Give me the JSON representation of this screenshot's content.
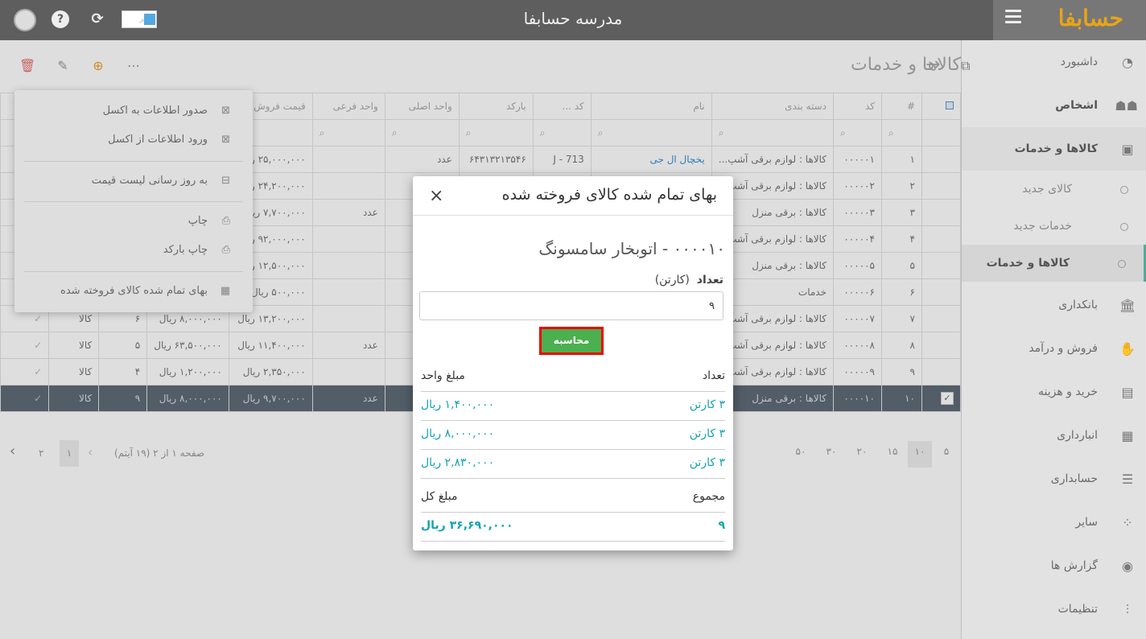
{
  "topbar": {
    "title": "مدرسه حسابفا",
    "brand": "حسابفا",
    "logo_box_text": "خبر"
  },
  "sidebar": {
    "items": [
      {
        "label": "داشبورد",
        "icon": "dashboard-icon"
      },
      {
        "label": "اشخاص",
        "icon": "people-icon"
      },
      {
        "label": "کالاها و خدمات",
        "icon": "box-icon"
      },
      {
        "label": "بانکداری",
        "icon": "bank-icon"
      },
      {
        "label": "فروش و درآمد",
        "icon": "sales-icon"
      },
      {
        "label": "خرید و هزینه",
        "icon": "wallet-icon"
      },
      {
        "label": "انبارداری",
        "icon": "warehouse-icon"
      },
      {
        "label": "حسابداری",
        "icon": "ledger-icon"
      },
      {
        "label": "سایر",
        "icon": "other-icon"
      },
      {
        "label": "گزارش ها",
        "icon": "report-icon"
      },
      {
        "label": "تنظیمات",
        "icon": "settings-icon"
      }
    ],
    "subitems": [
      "کالای جدید",
      "خدمات جدید",
      "کالاها و خدمات"
    ]
  },
  "page": {
    "title": "کالاها و خدمات"
  },
  "grid": {
    "columns": [
      "#",
      "کد",
      "دسته بندی",
      "نام",
      "کد ...",
      "بارکد",
      "واحد اصلی",
      "واحد فرعی",
      "قیمت فروش"
    ],
    "rows": [
      {
        "n": "۱",
        "code": "۰۰۰۰۰۱",
        "cat": "کالاها : لوازم برقی آشپ...",
        "name": "یخچال ال جی",
        "code2": "J - 713",
        "barcode": "۶۴۳۱۳۲۱۳۵۴۶",
        "unit": "عدد",
        "subunit": "",
        "price": "۲۵,۰۰۰,۰۰۰ ریال",
        "e1": "",
        "e2": "",
        "e3": ""
      },
      {
        "n": "۲",
        "code": "۰۰۰۰۰۲",
        "cat": "کالاها : لوازم برقی آشپ...",
        "name": "",
        "code2": "",
        "barcode": "",
        "unit": "",
        "subunit": "",
        "price": "۲۴,۲۰۰,۰۰۰ ریال",
        "e1": "",
        "e2": "",
        "e3": ""
      },
      {
        "n": "۳",
        "code": "۰۰۰۰۰۳",
        "cat": "کالاها : برقی منزل",
        "name": "",
        "code2": "",
        "barcode": "",
        "unit": "",
        "subunit": "عدد",
        "price": "۷,۷۰۰,۰۰۰ ریال",
        "e1": "",
        "e2": "",
        "e3": ""
      },
      {
        "n": "۴",
        "code": "۰۰۰۰۰۴",
        "cat": "کالاها : لوازم برقی آشپ...",
        "name": "",
        "code2": "",
        "barcode": "",
        "unit": "",
        "subunit": "",
        "price": "۹۲,۰۰۰,۰۰۰ ریال",
        "e1": "",
        "e2": "",
        "e3": ""
      },
      {
        "n": "۵",
        "code": "۰۰۰۰۰۵",
        "cat": "کالاها : برقی منزل",
        "name": "",
        "code2": "",
        "barcode": "",
        "unit": "",
        "subunit": "",
        "price": "۱۲,۵۰۰,۰۰۰ ریال",
        "e1": "",
        "e2": "",
        "e3": ""
      },
      {
        "n": "۶",
        "code": "۰۰۰۰۰۶",
        "cat": "خدمات",
        "name": "",
        "code2": "",
        "barcode": "",
        "unit": "",
        "subunit": "",
        "price": "۵۰۰,۰۰۰ ریال",
        "e1": "",
        "e2": "",
        "e3": ""
      },
      {
        "n": "۷",
        "code": "۰۰۰۰۰۷",
        "cat": "کالاها : لوازم برقی آشپ...",
        "name": "",
        "code2": "",
        "barcode": "",
        "unit": "",
        "subunit": "",
        "price": "۱۳,۲۰۰,۰۰۰ ریال",
        "e1": "۸,۰۰۰,۰۰۰ ریال",
        "e2": "۶",
        "e3": "کالا"
      },
      {
        "n": "۸",
        "code": "۰۰۰۰۰۸",
        "cat": "کالاها : لوازم برقی آشپ...",
        "name": "",
        "code2": "",
        "barcode": "",
        "unit": "",
        "subunit": "عدد",
        "price": "۱۱,۴۰۰,۰۰۰ ریال",
        "e1": "۶۳,۵۰۰,۰۰۰ ریال",
        "e2": "۵",
        "e3": "کالا"
      },
      {
        "n": "۹",
        "code": "۰۰۰۰۰۹",
        "cat": "کالاها : لوازم برقی آشپ...",
        "name": "",
        "code2": "",
        "barcode": "",
        "unit": "",
        "subunit": "",
        "price": "۲,۳۵۰,۰۰۰ ریال",
        "e1": "۱,۲۰۰,۰۰۰ ریال",
        "e2": "۴",
        "e3": "کالا"
      },
      {
        "n": "۱۰",
        "code": "۰۰۰۰۱۰",
        "cat": "کالاها : برقی منزل",
        "name": "",
        "code2": "",
        "barcode": "",
        "unit": "",
        "subunit": "عدد",
        "price": "۹,۷۰۰,۰۰۰ ریال",
        "e1": "۸,۰۰۰,۰۰۰ ریال",
        "e2": "۹",
        "e3": "کالا"
      }
    ]
  },
  "menu": {
    "export_excel": "صدور اطلاعات به اکسل",
    "import_excel": "ورود اطلاعات از اکسل",
    "update_prices": "به روز رسانی لیست قیمت",
    "print": "چاپ",
    "print_barcode": "چاپ بارکد",
    "cost_of_sold": "بهای تمام شده کالای فروخته شده"
  },
  "pager": {
    "sizes": [
      "۵",
      "۱۰",
      "۱۵",
      "۲۰",
      "۳۰",
      "۵۰"
    ],
    "info": "صفحه ۱ از ۲ (۱۹ آیتم)",
    "page1": "۱",
    "page2": "۲"
  },
  "dialog": {
    "title": "بهای تمام شده کالای فروخته شده",
    "product": "۰۰۰۰۱۰ - اتوبخار سامسونگ",
    "qty_label": "تعداد",
    "qty_unit": "(کارتن)",
    "qty_value": "۹",
    "calc_button": "محاسبه",
    "col_qty": "تعداد",
    "col_unit_price": "مبلغ واحد",
    "rows": [
      {
        "qty": "۳  کارتن",
        "price": "۱,۴۰۰,۰۰۰ ریال"
      },
      {
        "qty": "۳  کارتن",
        "price": "۸,۰۰۰,۰۰۰ ریال"
      },
      {
        "qty": "۳  کارتن",
        "price": "۲,۸۳۰,۰۰۰ ریال"
      }
    ],
    "sum_label": "مجموع",
    "total_label": "مبلغ کل",
    "sum_qty": "۹",
    "total": "۳۶,۶۹۰,۰۰۰ ریال"
  },
  "colors": {
    "accent": "#13a3b3",
    "calc_button": "#4caf50",
    "highlight_border": "#ee0000",
    "brand": "#e8a417"
  }
}
